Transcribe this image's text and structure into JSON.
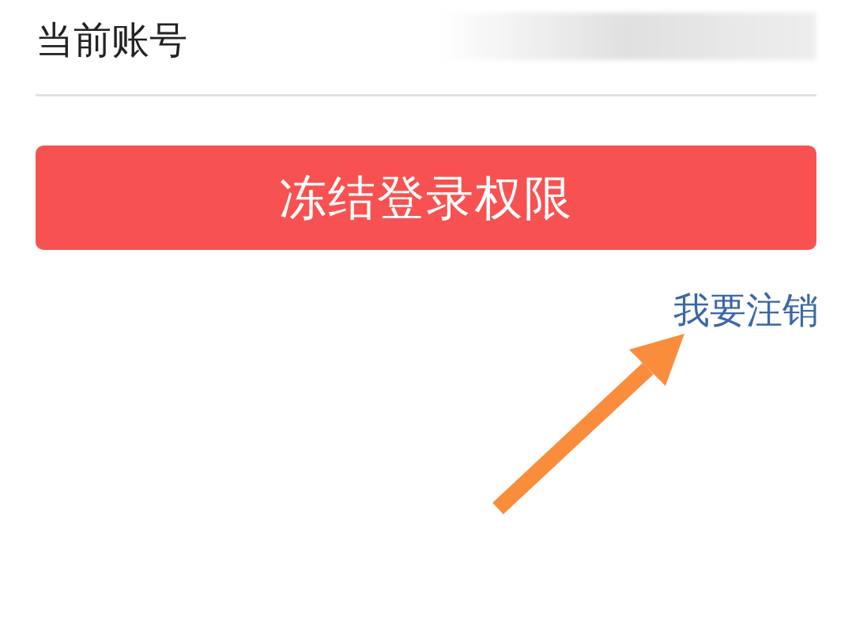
{
  "account": {
    "label": "当前账号"
  },
  "primary_button": {
    "label": "冻结登录权限"
  },
  "link": {
    "label": "我要注销"
  }
}
